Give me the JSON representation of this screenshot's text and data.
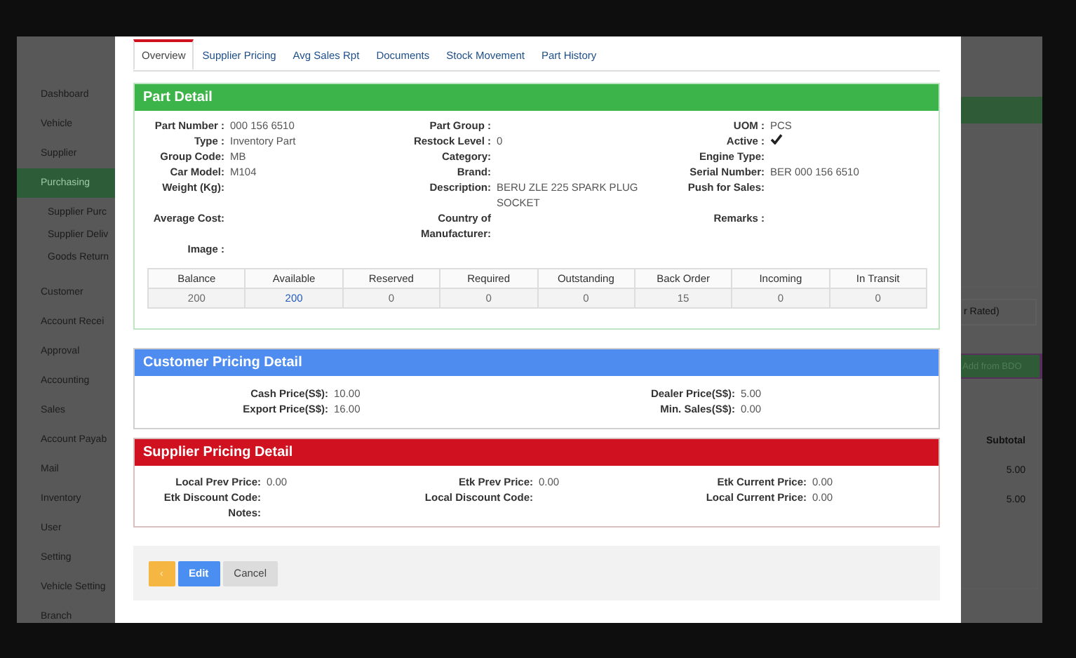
{
  "sidebar": {
    "items": [
      {
        "label": "Dashboard",
        "selected": false
      },
      {
        "label": "Vehicle",
        "selected": false
      },
      {
        "label": "Supplier",
        "selected": false
      },
      {
        "label": "Purchasing",
        "selected": true,
        "children": [
          {
            "label": "Supplier Purc",
            "selected": false
          },
          {
            "label": "Supplier Deliv",
            "selected": false
          },
          {
            "label": "Goods Return",
            "selected": false
          }
        ]
      },
      {
        "label": "Customer",
        "selected": false
      },
      {
        "label": "Account Recei",
        "selected": false
      },
      {
        "label": "Approval",
        "selected": false
      },
      {
        "label": "Accounting",
        "selected": false
      },
      {
        "label": "Sales",
        "selected": false
      },
      {
        "label": "Account Payab",
        "selected": false
      },
      {
        "label": "Mail",
        "selected": false
      },
      {
        "label": "Inventory",
        "selected": false
      },
      {
        "label": "User",
        "selected": false
      },
      {
        "label": "Setting",
        "selected": false
      },
      {
        "label": "Vehicle Setting",
        "selected": false
      },
      {
        "label": "Branch",
        "selected": false
      }
    ]
  },
  "modal": {
    "tabs": [
      {
        "label": "Overview",
        "selected": true
      },
      {
        "label": "Supplier Pricing",
        "selected": false
      },
      {
        "label": "Avg Sales Rpt",
        "selected": false
      },
      {
        "label": "Documents",
        "selected": false
      },
      {
        "label": "Stock Movement",
        "selected": false
      },
      {
        "label": "Part History",
        "selected": false
      }
    ],
    "part_detail": {
      "title": "Part Detail",
      "rows": [
        [
          {
            "kind": "text",
            "label": "Part Number :",
            "value": "000 156 6510"
          },
          {
            "kind": "text",
            "label": "Part Group :"
          },
          {
            "kind": "text",
            "label": "UOM :",
            "value": "PCS"
          }
        ],
        [
          {
            "kind": "text",
            "label": "Type :",
            "value": "Inventory Part"
          },
          {
            "kind": "text",
            "label": "Restock Level :",
            "value": "0"
          },
          {
            "kind": "check",
            "label": "Active :",
            "checked": true
          }
        ],
        [
          {
            "kind": "text",
            "label": "Group Code:",
            "value": "MB"
          },
          {
            "kind": "text",
            "label": "Category:"
          },
          {
            "kind": "text",
            "label": "Engine Type:"
          }
        ],
        [
          {
            "kind": "text",
            "label": "Car Model:",
            "value": "M104"
          },
          {
            "kind": "text",
            "label": "Brand:"
          },
          {
            "kind": "text",
            "label": "Serial Number:",
            "value": "BER 000 156 6510"
          }
        ],
        [
          {
            "kind": "text",
            "label": "Weight (Kg):"
          },
          {
            "kind": "text",
            "label": "Description:",
            "value": "BERU ZLE 225 SPARK PLUG SOCKET"
          },
          {
            "kind": "text",
            "label": "Push for Sales:"
          }
        ],
        [
          {
            "kind": "text",
            "label": "Average Cost:"
          },
          {
            "kind": "text",
            "label": "Country of Manufacturer:"
          },
          {
            "kind": "text",
            "label": "Remarks :"
          }
        ],
        [
          {
            "kind": "text",
            "label": "Image :"
          }
        ]
      ],
      "stock_table": {
        "columns": [
          "Balance",
          "Available",
          "Reserved",
          "Required",
          "Outstanding",
          "Back Order",
          "Incoming",
          "In Transit"
        ],
        "rows": [
          [
            {
              "text": "200",
              "link": false
            },
            {
              "text": "200",
              "link": true
            },
            {
              "text": "0",
              "link": false
            },
            {
              "text": "0",
              "link": false
            },
            {
              "text": "0",
              "link": false
            },
            {
              "text": "15",
              "link": false
            },
            {
              "text": "0",
              "link": false
            },
            {
              "text": "0",
              "link": false
            }
          ]
        ]
      }
    },
    "customer_pricing": {
      "title": "Customer Pricing Detail",
      "rows": [
        [
          {
            "label": "Cash Price(S$):",
            "value": "10.00"
          },
          {
            "label": "Dealer Price(S$):",
            "value": "5.00"
          }
        ],
        [
          {
            "label": "Export Price(S$):",
            "value": "16.00"
          },
          {
            "label": "Min. Sales(S$):",
            "value": "0.00"
          }
        ]
      ]
    },
    "supplier_pricing": {
      "title": "Supplier Pricing Detail",
      "rows": [
        [
          {
            "label": "Local Prev Price:",
            "value": "0.00"
          },
          {
            "label": "Etk Prev Price:",
            "value": "0.00"
          },
          {
            "label": "Etk Current Price:",
            "value": "0.00"
          }
        ],
        [
          {
            "label": "Etk Discount Code:"
          },
          {
            "label": "Local Discount Code:"
          },
          {
            "label": "Local Current Price:",
            "value": "0.00"
          }
        ],
        [
          {
            "label": "Notes:"
          }
        ]
      ]
    },
    "buttons": [
      {
        "label": "‹",
        "kind": "warning"
      },
      {
        "label": "Edit",
        "kind": "primary"
      },
      {
        "label": "Cancel",
        "kind": "default"
      }
    ]
  },
  "background_page": {
    "dropdown": {
      "value": "r Rated)"
    },
    "add_button": "Add from BDO",
    "table": {
      "columns": [
        "Subtotal"
      ],
      "rows": [
        [
          "5.00"
        ],
        [
          "5.00"
        ]
      ]
    }
  }
}
